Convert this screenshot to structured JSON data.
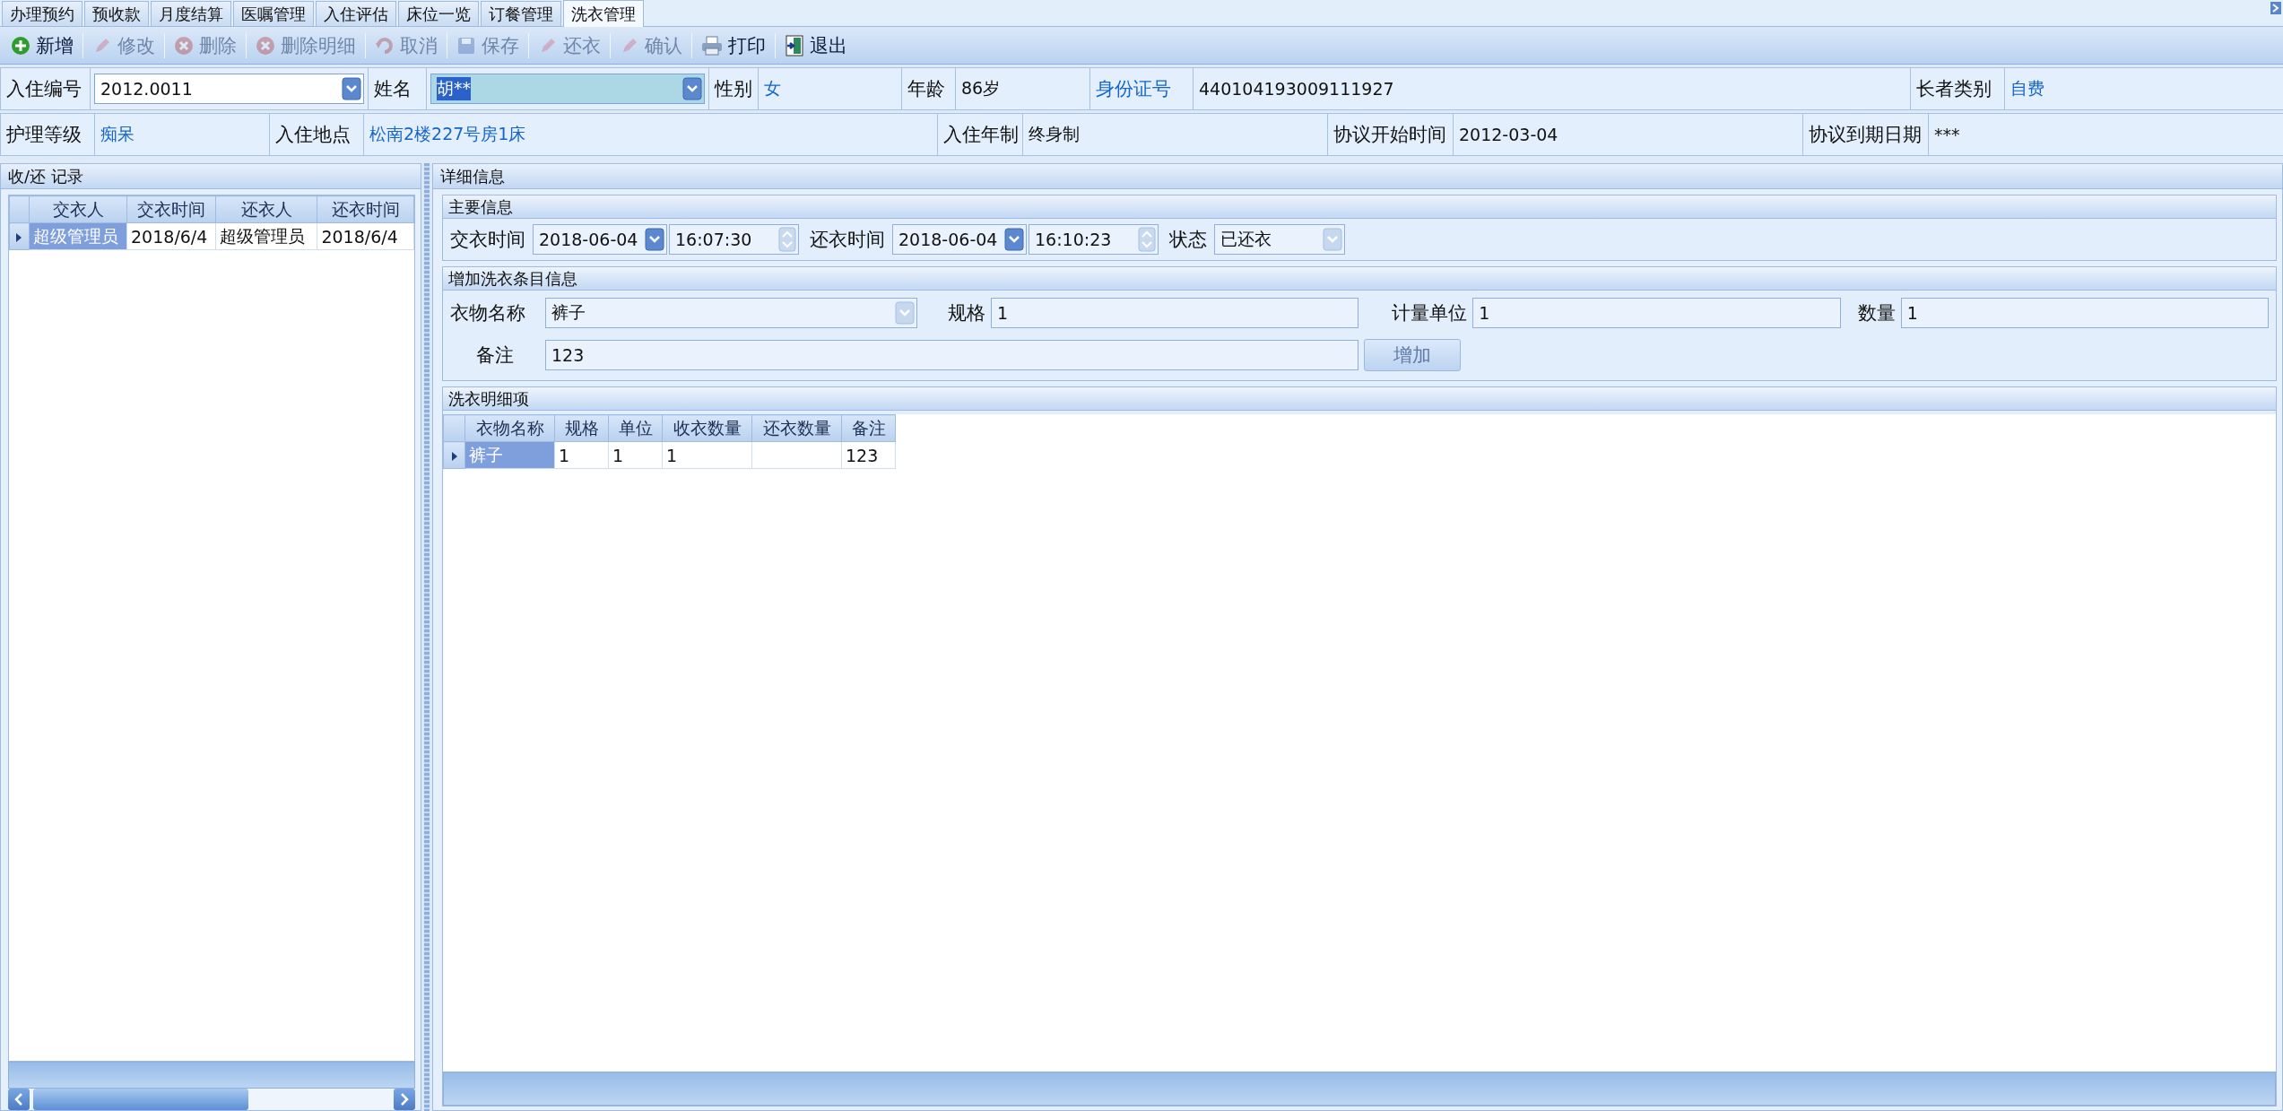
{
  "tabs": [
    {
      "label": "办理预约",
      "selected": false
    },
    {
      "label": "预收款",
      "selected": false
    },
    {
      "label": "月度结算",
      "selected": false
    },
    {
      "label": "医嘱管理",
      "selected": false
    },
    {
      "label": "入住评估",
      "selected": false
    },
    {
      "label": "床位一览",
      "selected": false
    },
    {
      "label": "订餐管理",
      "selected": false
    },
    {
      "label": "洗衣管理",
      "selected": true
    }
  ],
  "toolbar": [
    {
      "kind": "add",
      "label": "新增",
      "disabled": false
    },
    {
      "kind": "edit",
      "label": "修改",
      "disabled": true
    },
    {
      "kind": "delete",
      "label": "删除",
      "disabled": true
    },
    {
      "kind": "delete",
      "label": "删除明细",
      "disabled": true
    },
    {
      "kind": "cancel",
      "label": "取消",
      "disabled": true
    },
    {
      "kind": "save",
      "label": "保存",
      "disabled": true
    },
    {
      "kind": "edit",
      "label": "还衣",
      "disabled": true
    },
    {
      "kind": "edit",
      "label": "确认",
      "disabled": true
    },
    {
      "kind": "print",
      "label": "打印",
      "disabled": false
    },
    {
      "kind": "exit",
      "label": "退出",
      "disabled": false
    }
  ],
  "resident": {
    "upper_fields": [
      {
        "label": "入住编号",
        "value": "2012.0011",
        "kind": "combo",
        "highlighted": false
      },
      {
        "label": "姓名",
        "value": "胡**",
        "kind": "combo",
        "highlighted": true
      },
      {
        "label": "性别",
        "value": "女",
        "kind": "link"
      },
      {
        "label": "年龄",
        "value": "86岁",
        "kind": "plain"
      },
      {
        "label": "身份证号",
        "label_link": true,
        "value": "440104193009111927",
        "kind": "plain"
      },
      {
        "label": "长者类别",
        "value": "自费",
        "kind": "link"
      }
    ],
    "lower_fields": [
      {
        "label": "护理等级",
        "value": "痴呆",
        "kind": "link"
      },
      {
        "label": "入住地点",
        "value": "松南2楼227号房1床",
        "kind": "link"
      },
      {
        "label": "入住年制",
        "value": "终身制",
        "kind": "plain"
      },
      {
        "label": "协议开始时间",
        "value": "2012-03-04",
        "kind": "plain"
      },
      {
        "label": "协议到期日期",
        "value": "***",
        "kind": "plain"
      }
    ]
  },
  "records": {
    "title": "收/还 记录",
    "columns": [
      "交衣人",
      "交衣时间",
      "还衣人",
      "还衣时间"
    ],
    "rows": [
      {
        "cells": [
          "超级管理员",
          "2018/6/4",
          "超级管理员",
          "2018/6/4"
        ],
        "selected": true
      }
    ]
  },
  "detail": {
    "title": "详细信息",
    "main_info": {
      "title": "主要信息",
      "times": [
        {
          "label": "交衣时间",
          "date": "2018-06-04",
          "time": "16:07:30"
        },
        {
          "label": "还衣时间",
          "date": "2018-06-04",
          "time": "16:10:23"
        }
      ],
      "status": {
        "label": "状态",
        "value": "已还衣"
      }
    },
    "item_form": {
      "title": "增加洗衣条目信息",
      "fields": [
        {
          "label": "衣物名称",
          "value": "裤子",
          "kind": "combo"
        },
        {
          "label": "规格",
          "value": "1",
          "kind": "text"
        },
        {
          "label": "计量单位",
          "value": "1",
          "kind": "text"
        },
        {
          "label": "数量",
          "value": "1",
          "kind": "text"
        },
        {
          "label": "备注",
          "value": "123",
          "kind": "text"
        }
      ],
      "button": {
        "label": "增加",
        "disabled": true
      }
    },
    "items": {
      "title": "洗衣明细项",
      "columns": [
        "衣物名称",
        "规格",
        "单位",
        "收衣数量",
        "还衣数量",
        "备注"
      ],
      "rows": [
        {
          "cells": [
            "裤子",
            "1",
            "1",
            "1",
            "",
            "123"
          ],
          "selected": true
        }
      ]
    }
  }
}
